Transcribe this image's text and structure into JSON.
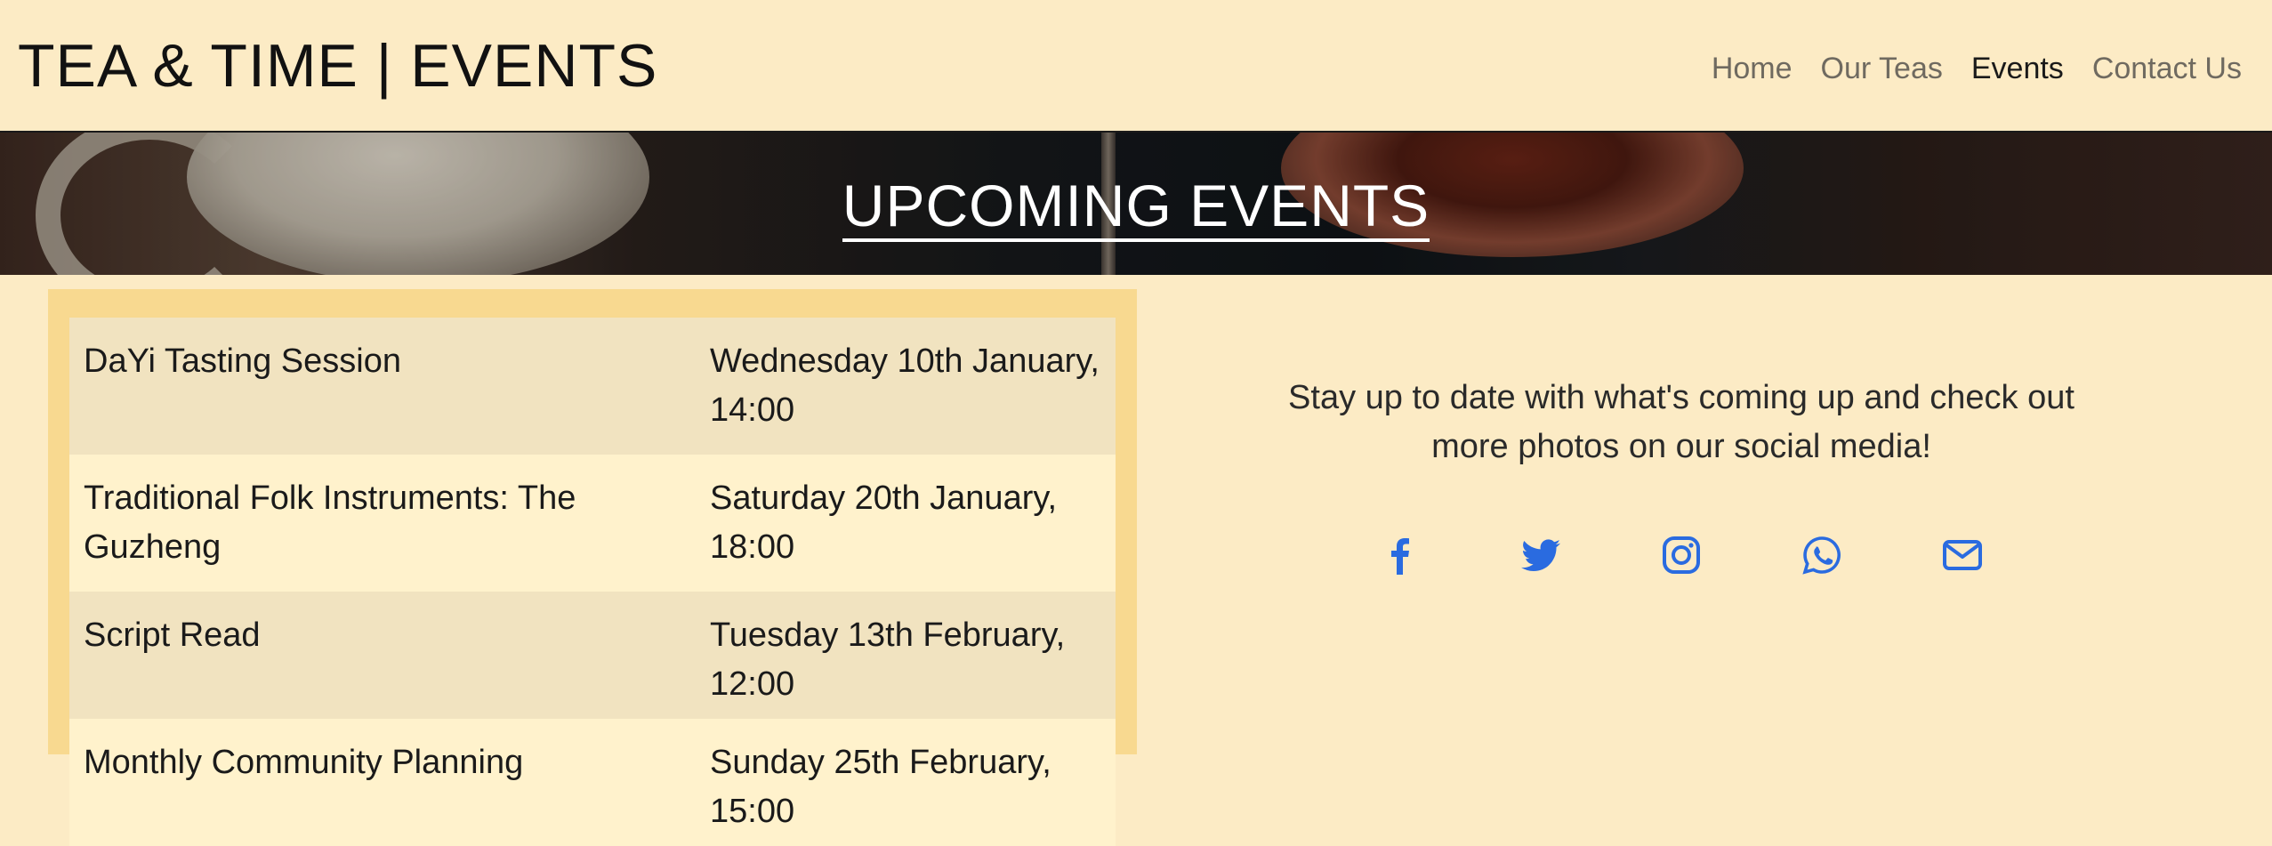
{
  "header": {
    "title": "TEA & TIME | EVENTS",
    "nav": [
      {
        "label": "Home",
        "active": false
      },
      {
        "label": "Our Teas",
        "active": false
      },
      {
        "label": "Events",
        "active": true
      },
      {
        "label": "Contact Us",
        "active": false
      }
    ]
  },
  "hero": {
    "title": "UPCOMING EVENTS"
  },
  "events": [
    {
      "name": "DaYi Tasting Session",
      "date": "Wednesday 10th January, 14:00"
    },
    {
      "name": "Traditional Folk Instruments: The Guzheng",
      "date": "Saturday 20th January, 18:00"
    },
    {
      "name": "Script Read",
      "date": "Tuesday 13th February, 12:00"
    },
    {
      "name": "Monthly Community Planning",
      "date": "Sunday 25th February, 15:00"
    }
  ],
  "social": {
    "text": "Stay up to date with what's coming up and check out more photos on our social media!",
    "icons": [
      "facebook-icon",
      "twitter-icon",
      "instagram-icon",
      "whatsapp-icon",
      "email-icon"
    ],
    "icon_color": "#2a6be0"
  },
  "colors": {
    "background": "#fcebc5",
    "table_frame": "#f8d990",
    "row_odd": "#f1e3c0",
    "row_even": "#fff2cc"
  }
}
